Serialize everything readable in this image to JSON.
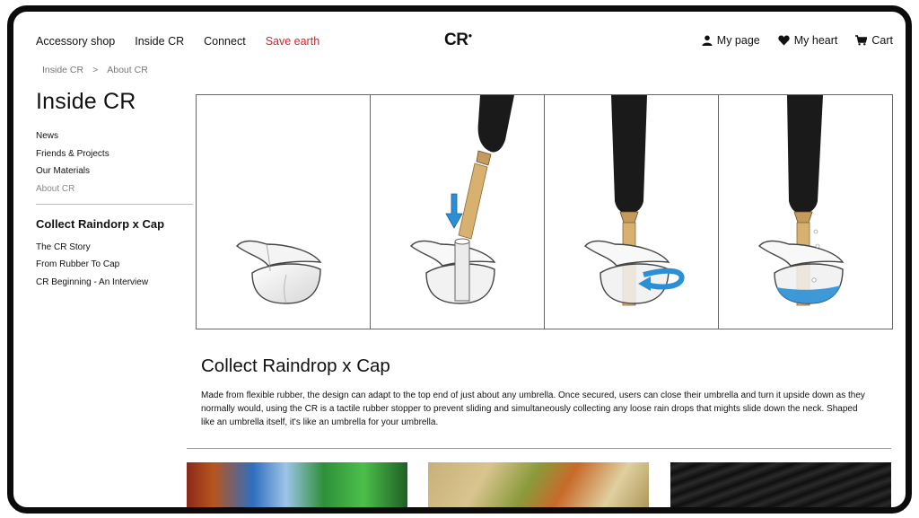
{
  "nav": {
    "left": [
      "Accessory shop",
      "Inside CR",
      "Connect",
      "Save earth"
    ],
    "logo": "CR",
    "right": [
      "My page",
      "My heart",
      "Cart"
    ]
  },
  "breadcrumb": [
    "Inside CR",
    ">",
    "About CR"
  ],
  "sidebar": {
    "heading": "Inside CR",
    "menu": [
      "News",
      "Friends & Projects",
      "Our Materials",
      "About CR"
    ],
    "section_title": "Collect Raindorp x Cap",
    "sub": [
      "The CR Story",
      "From Rubber To Cap",
      "CR Beginning - An Interview"
    ]
  },
  "article": {
    "title": "Collect Raindrop x Cap",
    "body": "Made from flexible rubber, the design can adapt to the top end of just about any umbrella. Once secured, users can close their umbrella and turn it upside down as they normally would, using the CR is a tactile rubber stopper to prevent sliding and simultaneously collecting any loose rain drops that mights slide down the neck. Shaped like an umbrella itself, it's like an umbrella for your umbrella."
  },
  "colors": {
    "accent_red": "#d8202a",
    "arrow_blue": "#2a8fd6"
  },
  "icons": [
    "user-icon",
    "heart-icon",
    "cart-icon"
  ]
}
